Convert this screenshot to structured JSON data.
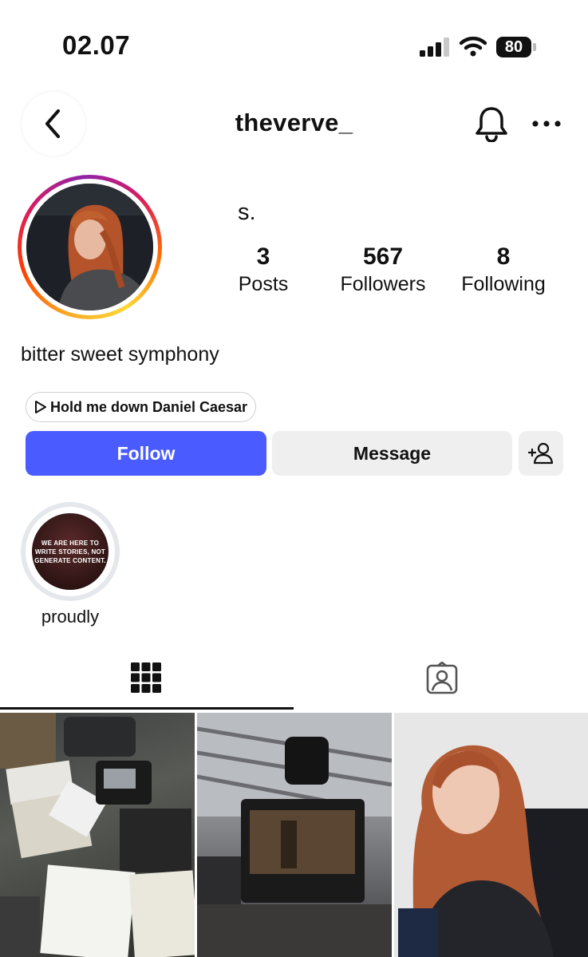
{
  "status_bar": {
    "time": "02.07",
    "battery": "80"
  },
  "header": {
    "username": "theverve_"
  },
  "profile": {
    "display_name": "s.",
    "stats": [
      {
        "value": "3",
        "label": "Posts"
      },
      {
        "value": "567",
        "label": "Followers"
      },
      {
        "value": "8",
        "label": "Following"
      }
    ],
    "bio": "bitter sweet symphony",
    "music": "Hold me down Daniel Caesar"
  },
  "actions": {
    "follow": "Follow",
    "message": "Message"
  },
  "highlights": [
    {
      "label": "proudly",
      "cover_text": "WE ARE HERE TO WRITE STORIES, NOT GENERATE CONTENT."
    }
  ],
  "colors": {
    "follow_button": "#4a5cff",
    "secondary_button": "#efefef"
  },
  "icons": [
    "back-icon",
    "bell-icon",
    "more-icon",
    "play-icon",
    "add-user-icon",
    "grid-icon",
    "tagged-icon"
  ]
}
